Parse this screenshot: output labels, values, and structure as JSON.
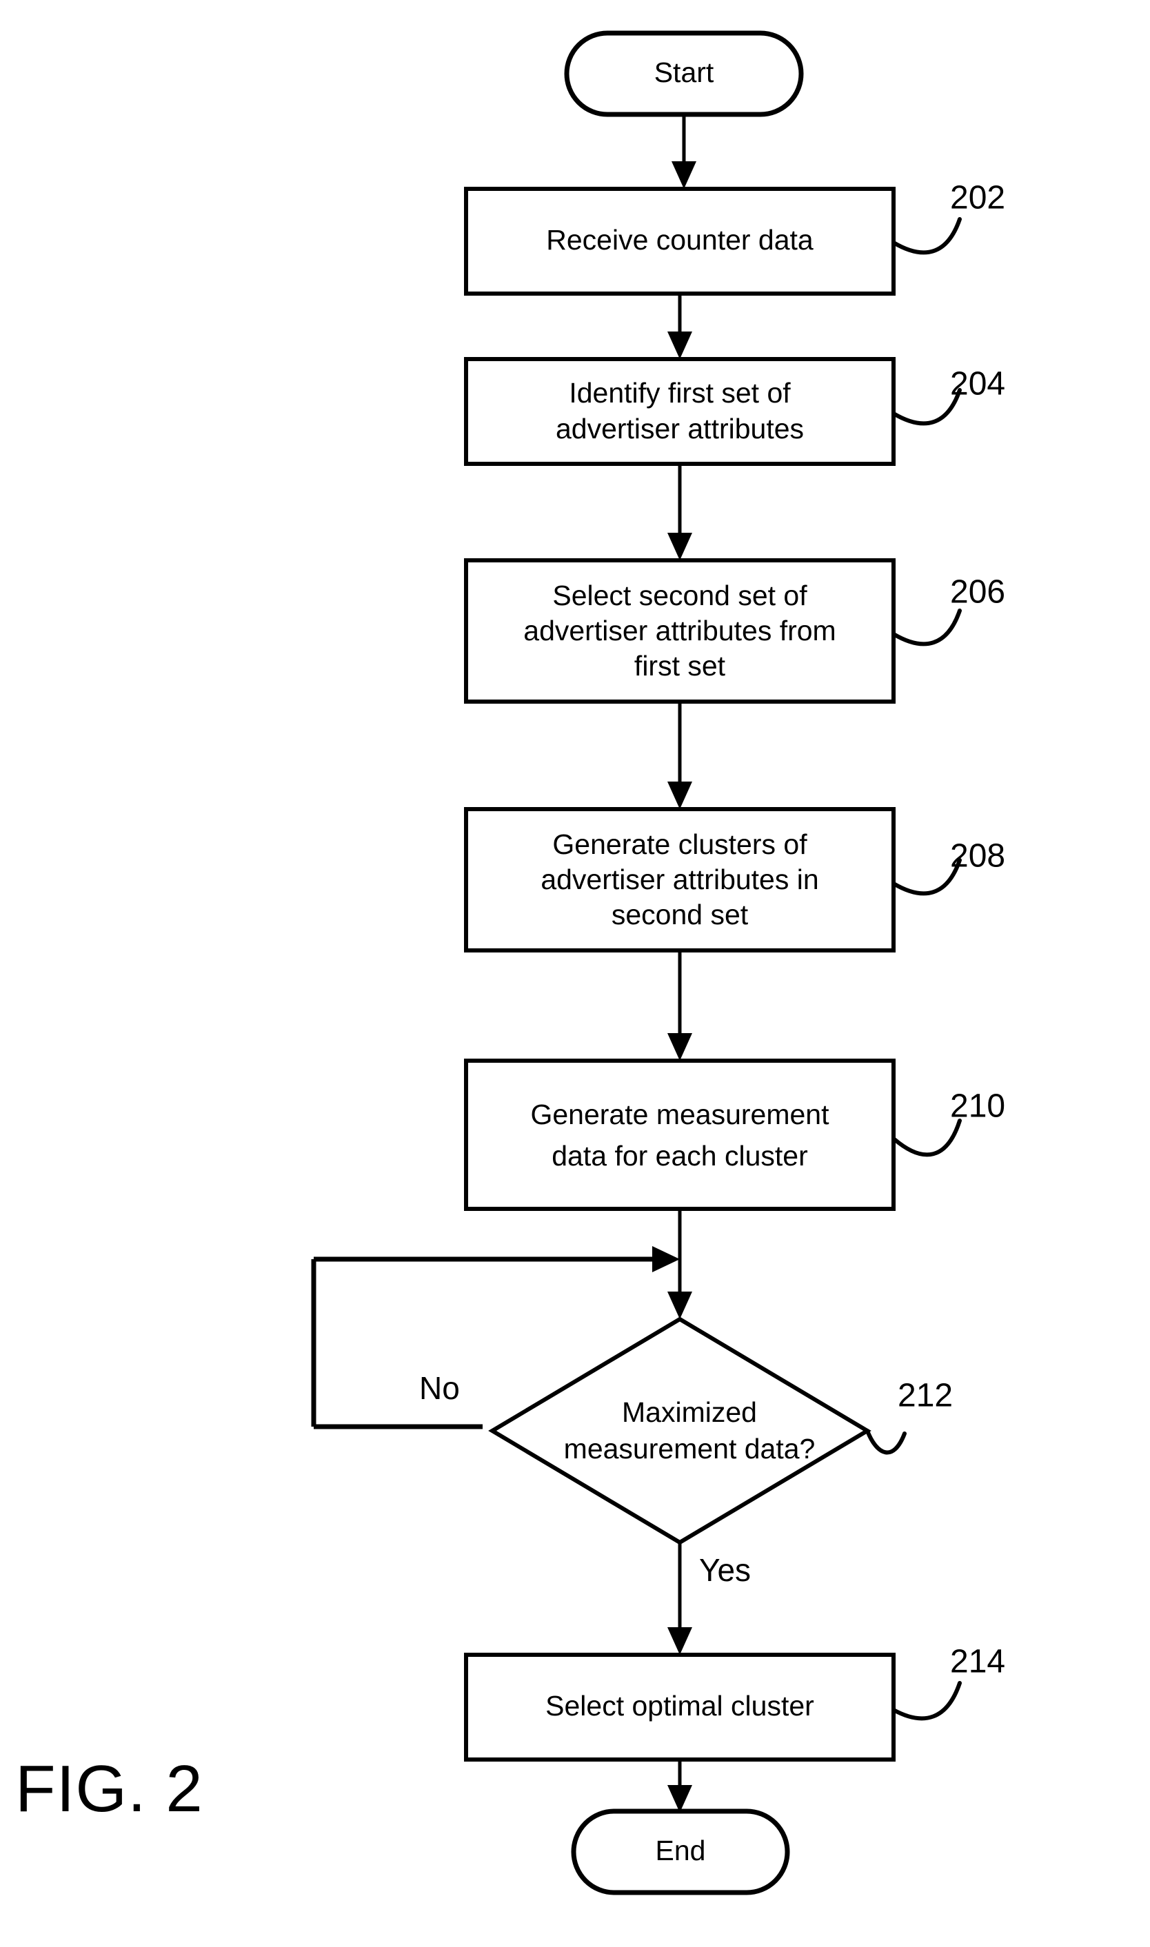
{
  "figure": {
    "label": "FIG. 2",
    "title_number": "2"
  },
  "flowchart": {
    "nodes": [
      {
        "id": "start",
        "type": "terminator",
        "label": "Start",
        "ref": ""
      },
      {
        "id": "n202",
        "type": "process",
        "label": "Receive counter data",
        "lines": [
          "Receive counter data"
        ],
        "ref": "202"
      },
      {
        "id": "n204",
        "type": "process",
        "label": "Identify first set of advertiser attributes",
        "lines": [
          "Identify first set of",
          "advertiser attributes"
        ],
        "ref": "204"
      },
      {
        "id": "n206",
        "type": "process",
        "label": "Select second set of advertiser attributes from first set",
        "lines": [
          "Select second set of",
          "advertiser attributes from",
          "first set"
        ],
        "ref": "206"
      },
      {
        "id": "n208",
        "type": "process",
        "label": "Generate clusters of advertiser attributes in second set",
        "lines": [
          "Generate clusters of",
          "advertiser attributes in",
          "second set"
        ],
        "ref": "208"
      },
      {
        "id": "n210",
        "type": "process",
        "label": "Generate measurement data for each cluster",
        "lines": [
          "Generate measurement",
          "data for each cluster"
        ],
        "ref": "210"
      },
      {
        "id": "n212",
        "type": "decision",
        "label": "Maximized measurement data?",
        "lines": [
          "Maximized",
          "measurement data?"
        ],
        "ref": "212"
      },
      {
        "id": "n214",
        "type": "process",
        "label": "Select optimal cluster",
        "lines": [
          "Select optimal cluster"
        ],
        "ref": "214"
      },
      {
        "id": "end",
        "type": "terminator",
        "label": "End",
        "ref": ""
      }
    ],
    "branch_labels": {
      "no": "No",
      "yes": "Yes"
    },
    "colors": {
      "stroke": "#000000",
      "fill": "#ffffff",
      "background": "#ffffff"
    }
  }
}
